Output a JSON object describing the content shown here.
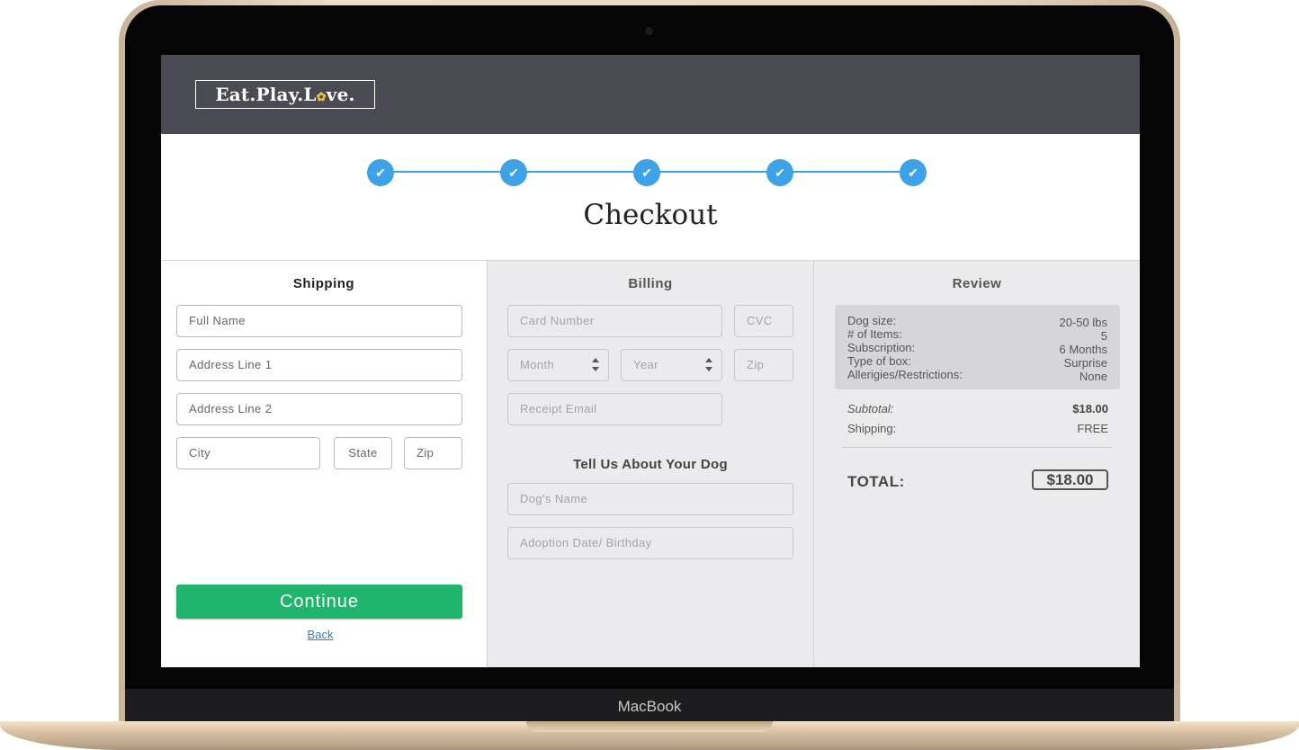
{
  "device": {
    "brand": "MacBook"
  },
  "header": {
    "logo": {
      "part1": "Eat.Play.L",
      "paw": "✿",
      "part2": "ve."
    }
  },
  "steps": [
    {
      "icon": "check-icon"
    },
    {
      "icon": "check-icon"
    },
    {
      "icon": "check-icon"
    },
    {
      "icon": "check-icon"
    },
    {
      "icon": "check-icon"
    }
  ],
  "colors": {
    "header_bg": "#4a4a52",
    "step_accent": "#3ea3e6",
    "continue_button": "#1fb56c",
    "link": "#2f7fc6",
    "logo_paw": "#f3c13a"
  },
  "page_title": "Checkout",
  "shipping": {
    "heading": "Shipping",
    "full_name": "Full Name",
    "address1": "Address Line 1",
    "address2": "Address Line 2",
    "city": "City",
    "state": "State",
    "zip": "Zip",
    "continue": "Continue",
    "back": "Back"
  },
  "billing": {
    "heading": "Billing",
    "card_number": "Card Number",
    "cvc": "CVC",
    "month": "Month",
    "year": "Year",
    "zip": "Zip",
    "receipt_email": "Receipt Email",
    "dog_heading": "Tell Us About Your Dog",
    "dog_name": "Dog's Name",
    "adoption_date": "Adoption Date/ Birthday"
  },
  "review": {
    "heading": "Review",
    "items": [
      {
        "label": "Dog size:",
        "value": "20-50 lbs"
      },
      {
        "label": "# of Items:",
        "value": "5"
      },
      {
        "label": "Subscription:",
        "value": "6 Months"
      },
      {
        "label": "Type of box:",
        "value": "Surprise"
      },
      {
        "label": "Allerigies/Restrictions:",
        "value": "None"
      }
    ],
    "subtotal_label": "Subtotal:",
    "subtotal_value": "$18.00",
    "shipping_label": "Shipping:",
    "shipping_value": "FREE",
    "total_label": "TOTAL:",
    "total_value": "$18.00"
  }
}
